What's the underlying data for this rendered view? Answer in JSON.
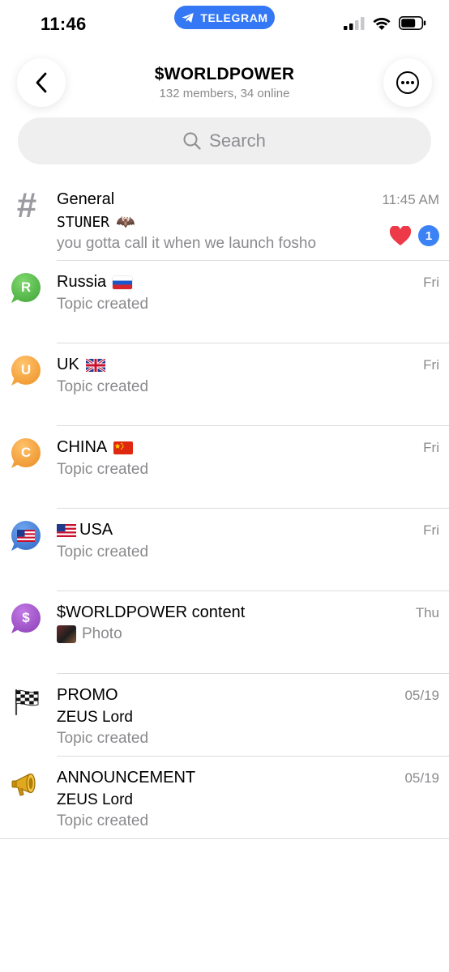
{
  "status_bar": {
    "time": "11:46",
    "pill_label": "TELEGRAM"
  },
  "header": {
    "title": "$WORLDPOWER",
    "subtitle": "132 members, 34 online"
  },
  "search": {
    "placeholder": "Search"
  },
  "topics": [
    {
      "title": "General",
      "time": "11:45 AM",
      "sender": "𝚂𝚃𝚄𝙽𝙴𝚁",
      "sender_emoji": "🦇",
      "preview": "you gotta call it when we launch fosho",
      "unread_count": "1",
      "reaction": "heart"
    },
    {
      "title": "Russia",
      "letter": "R",
      "color": "#56b84a",
      "flag": "ru",
      "time": "Fri",
      "preview": "Topic created"
    },
    {
      "title": "UK",
      "letter": "U",
      "color": "#f4a23c",
      "flag": "gb",
      "time": "Fri",
      "preview": "Topic created"
    },
    {
      "title": "CHINA",
      "letter": "C",
      "color": "#f0a036",
      "flag": "cn",
      "time": "Fri",
      "preview": "Topic created"
    },
    {
      "title": "USA",
      "color": "#3b7ad6",
      "flag": "us",
      "time": "Fri",
      "preview": "Topic created"
    },
    {
      "title": "$WORLDPOWER content",
      "letter": "$",
      "color": "#9b4fc2",
      "time": "Thu",
      "preview": "Photo"
    },
    {
      "title": "PROMO",
      "icon": "checkered-flag-icon",
      "time": "05/19",
      "sender": "ZEUS Lord",
      "preview": "Topic created"
    },
    {
      "title": "ANNOUNCEMENT",
      "icon": "megaphone-icon",
      "time": "05/19",
      "sender": "ZEUS Lord",
      "preview": "Topic created"
    }
  ]
}
